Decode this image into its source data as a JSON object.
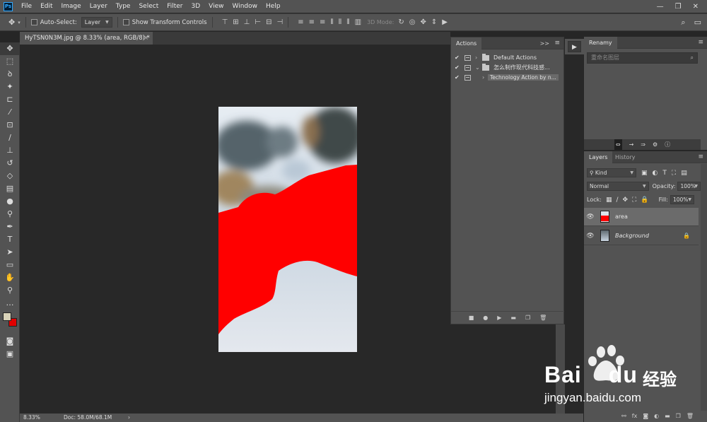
{
  "app": {
    "logo": "Ps"
  },
  "menu": [
    "File",
    "Edit",
    "Image",
    "Layer",
    "Type",
    "Select",
    "Filter",
    "3D",
    "View",
    "Window",
    "Help"
  ],
  "window_controls": [
    "—",
    "❐",
    "✕"
  ],
  "options": {
    "auto_select_label": "Auto-Select:",
    "auto_select_value": "Layer",
    "transform_label": "Show Transform Controls",
    "mode_3d": "3D Mode:"
  },
  "document": {
    "tab_title": "HyTSN0N3M.jpg @ 8.33% (area, RGB/8) *",
    "close": "×"
  },
  "status": {
    "zoom": "8.33%",
    "doc_size": "Doc: 58.0M/68.1M",
    "arrow": "›"
  },
  "actions_panel": {
    "tab": "Actions",
    "expand": ">>",
    "rows": [
      {
        "label": "Default Actions",
        "checked": true,
        "folder": true,
        "expanded": false
      },
      {
        "label": "怎么制作现代科技感...",
        "checked": true,
        "folder": true,
        "expanded": true
      },
      {
        "label": "Technology Action by n...",
        "checked": true,
        "folder": false,
        "expanded": false
      }
    ]
  },
  "renamy_panel": {
    "tab": "Renamy",
    "search_placeholder": "重命名图层"
  },
  "layers_panel": {
    "tabs": [
      "Layers",
      "History"
    ],
    "filter": "Kind",
    "blend_mode": "Normal",
    "opacity_label": "Opacity:",
    "opacity": "100%",
    "lock_label": "Lock:",
    "fill_label": "Fill:",
    "fill": "100%",
    "layers": [
      {
        "name": "area",
        "selected": true,
        "locked": false
      },
      {
        "name": "Background",
        "selected": false,
        "locked": true
      }
    ],
    "bottom_icons": [
      "link-icon",
      "fx-icon",
      "mask-icon",
      "adjustment-icon",
      "folder-icon",
      "new-layer-icon",
      "trash-icon"
    ]
  },
  "colors": {
    "accent": "#31a8ff",
    "foreground": "#d8d2b8",
    "background": "#e00000",
    "mask_red": "#ff0000"
  },
  "watermark": {
    "brand": "Bai",
    "brand_end": "du",
    "cn": "经验",
    "url": "jingyan.baidu.com"
  }
}
